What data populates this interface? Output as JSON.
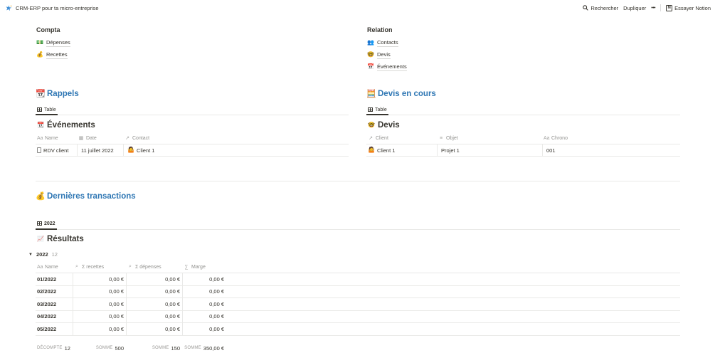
{
  "topbar": {
    "title": "CRM-ERP pour ta micro-entreprise",
    "search": "Rechercher",
    "duplicate": "Dupliquer",
    "more": "•••",
    "try_notion": "Essayer Notion"
  },
  "compta": {
    "title": "Compta",
    "items": [
      {
        "emoji": "💵",
        "label": "Dépenses"
      },
      {
        "emoji": "💰",
        "label": "Recettes"
      }
    ]
  },
  "relation": {
    "title": "Relation",
    "items": [
      {
        "emoji": "👥",
        "label": "Contacts"
      },
      {
        "emoji": "🤓",
        "label": "Devis"
      },
      {
        "emoji": "📅",
        "label": "Événements"
      }
    ]
  },
  "rappels": {
    "emoji": "📆",
    "title": "Rappels",
    "tab": "Table",
    "db_emoji": "📆",
    "db_title": "Événements",
    "columns": [
      {
        "icon": "Aa",
        "label": "Name"
      },
      {
        "icon": "▦",
        "label": "Date"
      },
      {
        "icon": "↗",
        "label": "Contact"
      }
    ],
    "rows": [
      {
        "name": "RDV client",
        "date": "11 juillet 2022",
        "contact_emoji": "🤷",
        "contact": "Client 1"
      }
    ]
  },
  "devis_en_cours": {
    "emoji": "🧮",
    "title": "Devis en cours",
    "tab": "Table",
    "db_emoji": "🤓",
    "db_title": "Devis",
    "columns": [
      {
        "icon": "↗",
        "label": "Client"
      },
      {
        "icon": "≡",
        "label": "Objet"
      },
      {
        "icon": "Aa",
        "label": "Chrono"
      }
    ],
    "rows": [
      {
        "client_emoji": "🤷",
        "client": "Client 1",
        "objet": "Projet 1",
        "chrono": "001"
      }
    ]
  },
  "transactions": {
    "emoji": "💰",
    "title": "Dernières transactions",
    "tab": "2022",
    "db_emoji": "📈",
    "db_title": "Résultats",
    "group": {
      "triangle": "▼",
      "label": "2022",
      "count": "12"
    },
    "columns": [
      {
        "icon": "Aa",
        "label": "Name"
      },
      {
        "icon": "⌕",
        "label": "Σ recettes"
      },
      {
        "icon": "⌕",
        "label": "Σ dépenses"
      },
      {
        "icon": "∑",
        "label": "Marge"
      }
    ],
    "rows": [
      {
        "name": "01/2022",
        "recettes": "0,00 €",
        "depenses": "0,00 €",
        "marge": "0,00 €"
      },
      {
        "name": "02/2022",
        "recettes": "0,00 €",
        "depenses": "0,00 €",
        "marge": "0,00 €"
      },
      {
        "name": "03/2022",
        "recettes": "0,00 €",
        "depenses": "0,00 €",
        "marge": "0,00 €"
      },
      {
        "name": "04/2022",
        "recettes": "0,00 €",
        "depenses": "0,00 €",
        "marge": "0,00 €"
      },
      {
        "name": "05/2022",
        "recettes": "0,00 €",
        "depenses": "0,00 €",
        "marge": "0,00 €"
      }
    ],
    "footer": [
      {
        "label": "DÉCOMPTE",
        "value": "12"
      },
      {
        "label": "SOMME",
        "value": "500"
      },
      {
        "label": "SOMME",
        "value": "150"
      },
      {
        "label": "SOMME",
        "value": "350,00 €"
      }
    ]
  }
}
